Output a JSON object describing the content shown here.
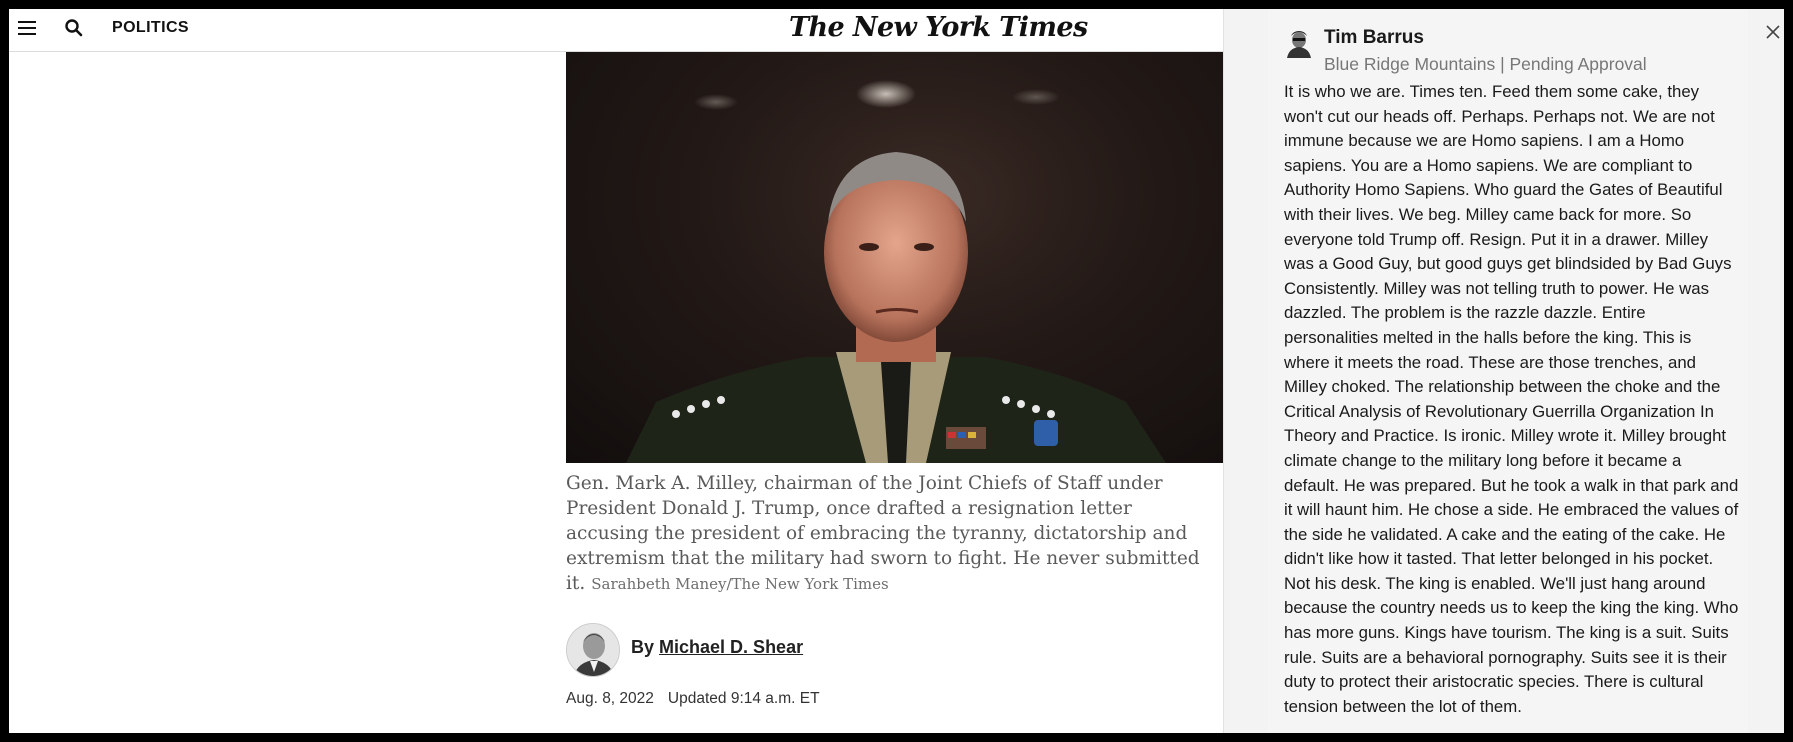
{
  "header": {
    "section": "POLITICS",
    "masthead": "The New York Times",
    "menu_icon": "menu-icon",
    "search_icon": "search-icon"
  },
  "article": {
    "caption": "Gen. Mark A. Milley, chairman of the Joint Chiefs of Staff under President Donald J. Trump, once drafted a resignation letter accusing the president of embracing the tyranny, dictatorship and extremism that the military had sworn to fight. He never submitted it.",
    "credit": "Sarahbeth Maney/The New York Times",
    "byline_prefix": "By",
    "author": "Michael D. Shear",
    "date": "Aug. 8, 2022",
    "updated": "Updated 9:14 a.m. ET"
  },
  "comment": {
    "name": "Tim Barrus",
    "meta": "Blue Ridge Mountains | Pending Approval",
    "body": "It is who we are. Times ten. Feed them some cake, they won't cut our heads off. Perhaps. Perhaps not. We are not immune because we are Homo sapiens. I am a Homo sapiens. You are a Homo sapiens. We are compliant to Authority Homo Sapiens. Who guard the Gates of Beautiful with their lives. We beg. Milley came back for more. So everyone told Trump off. Resign. Put it in a drawer. Milley was a Good Guy, but good guys get blindsided by Bad Guys Consistently. Milley was not telling truth to power. He was dazzled. The problem is the razzle dazzle. Entire personalities melted in the halls before the king. This is where it meets the road. These are those trenches, and Milley choked.  The relationship between the choke and the Critical Analysis of Revolutionary Guerrilla Organization In Theory and Practice. Is ironic. Milley wrote it. Milley brought climate change to the military long before it became a default. He was prepared. But he took a walk in that park and it will haunt him. He chose a side. He embraced the values of the side he validated. A cake and the eating of the cake. He didn't like how it tasted. That letter belonged in his pocket. Not his desk. The king is enabled. We'll just hang around because the country needs us to keep the king the king. Who has more guns. Kings have tourism. The king is a suit. Suits rule. Suits are a behavioral pornography. Suits see it is their duty to protect their aristocratic species. There is cultural tension between the lot of them."
  },
  "colors": {
    "panel_bg": "#f3f3f3",
    "caption_text": "#5a5a5a",
    "frame": "#000000"
  }
}
